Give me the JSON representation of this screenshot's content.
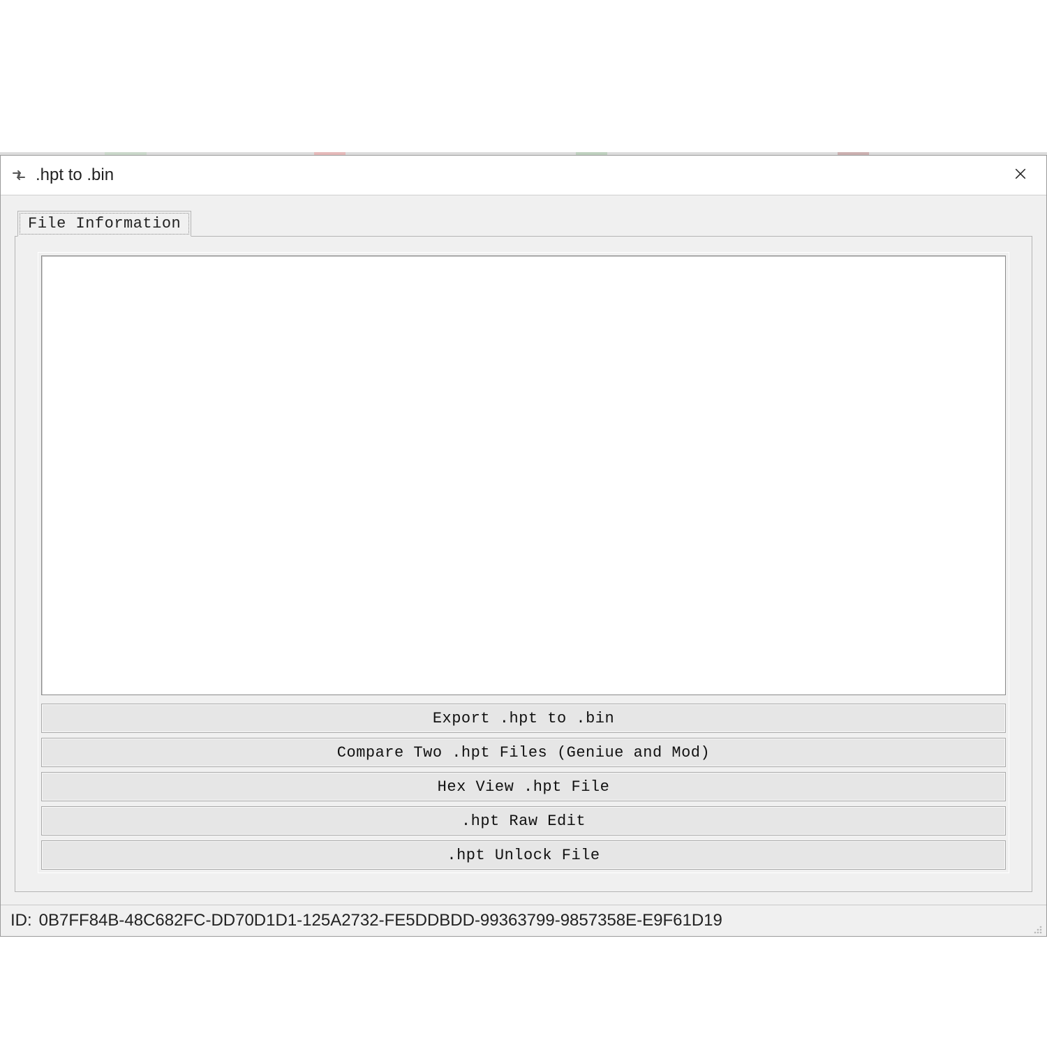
{
  "window": {
    "title": ".hpt to .bin",
    "icon_name": "convert-icon"
  },
  "tabs": [
    {
      "label": "File Information"
    }
  ],
  "buttons": {
    "export": "Export .hpt to .bin",
    "compare": "Compare Two .hpt Files (Geniue and Mod)",
    "hexview": "Hex View .hpt File",
    "rawedit": ".hpt Raw Edit",
    "unlock": ".hpt Unlock File"
  },
  "statusbar": {
    "id_label": "ID:",
    "id_value": "0B7FF84B-48C682FC-DD70D1D1-125A2732-FE5DDBDD-99363799-9857358E-E9F61D19"
  }
}
